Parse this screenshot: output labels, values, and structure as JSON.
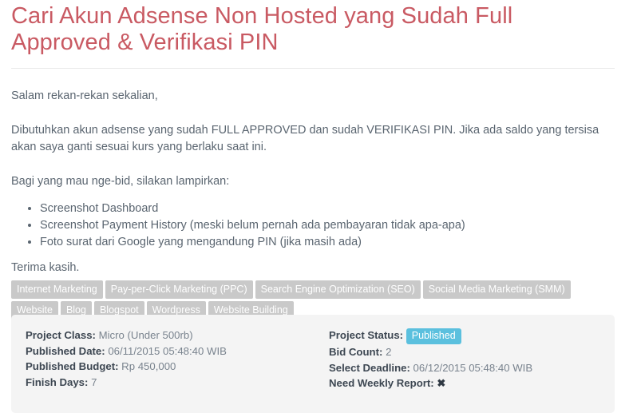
{
  "project": {
    "title": "Cari Akun Adsense Non Hosted yang Sudah Full Approved & Verifikasi PIN",
    "description": {
      "greeting": "Salam rekan-rekan sekalian,",
      "paragraph_1": "Dibutuhkan akun adsense yang sudah FULL APPROVED dan sudah VERIFIKASI PIN. Jika ada saldo yang tersisa akan saya ganti sesuai kurs yang berlaku saat ini.",
      "paragraph_2": "Bagi yang mau nge-bid, silakan lampirkan:",
      "attachments": [
        "Screenshot Dashboard",
        "Screenshot Payment History (meski belum pernah ada pembayaran tidak apa-apa)",
        "Foto surat dari Google yang mengandung PIN (jika masih ada)"
      ],
      "closing": "Terima kasih."
    },
    "tags": [
      "Internet Marketing",
      "Pay-per-Click Marketing (PPC)",
      "Search Engine Optimization (SEO)",
      "Social Media Marketing (SMM)",
      "Website",
      "Blog",
      "Blogspot",
      "Wordpress",
      "Website Building"
    ],
    "details": {
      "left": [
        {
          "label": "Project Class:",
          "value": "Micro (Under 500rb)"
        },
        {
          "label": "Published Date:",
          "value": "06/11/2015 05:48:40 WIB"
        },
        {
          "label": "Published Budget:",
          "value": "Rp 450,000"
        },
        {
          "label": "Finish Days:",
          "value": "7"
        }
      ],
      "right": {
        "status_label": "Project Status:",
        "status_value": "Published",
        "bid_count_label": "Bid Count:",
        "bid_count_value": "2",
        "deadline_label": "Select Deadline:",
        "deadline_value": "06/12/2015 05:48:40 WIB",
        "weekly_report_label": "Need Weekly Report:",
        "weekly_report_value": "✖"
      }
    }
  },
  "colors": {
    "title": "#c95a63",
    "body_text": "#5a6570",
    "tag_background": "#c9c9c9",
    "panel_background": "#f4f4f4",
    "status_badge": "#5bc0de"
  }
}
